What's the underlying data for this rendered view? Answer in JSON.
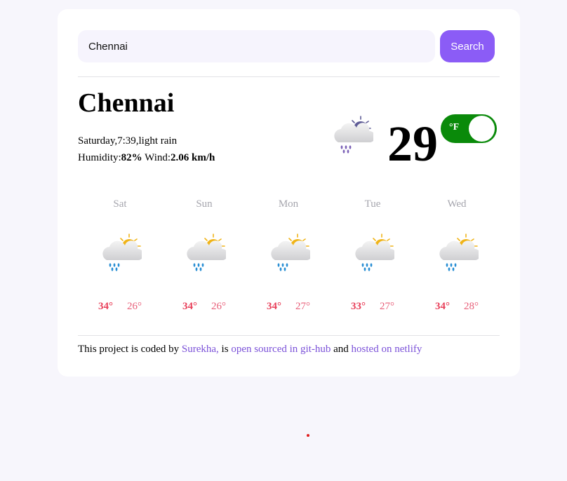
{
  "search": {
    "value": "Chennai",
    "button_label": "Search"
  },
  "current": {
    "city": "Chennai",
    "day_time_desc": "Saturday,7:39,light rain",
    "humidity_label": "Humidity:",
    "humidity_value": "82%",
    "wind_label": " Wind:",
    "wind_value": "2.06 km/h",
    "temperature": "29",
    "unit_toggle": "°F",
    "icon": "night-cloud-rain-icon"
  },
  "forecast": [
    {
      "day": "Sat",
      "high": "34°",
      "low": "26°",
      "icon": "sun-cloud-rain-icon"
    },
    {
      "day": "Sun",
      "high": "34°",
      "low": "26°",
      "icon": "sun-cloud-rain-icon"
    },
    {
      "day": "Mon",
      "high": "34°",
      "low": "27°",
      "icon": "sun-cloud-rain-icon"
    },
    {
      "day": "Tue",
      "high": "33°",
      "low": "27°",
      "icon": "sun-cloud-rain-icon"
    },
    {
      "day": "Wed",
      "high": "34°",
      "low": "28°",
      "icon": "sun-cloud-rain-icon"
    }
  ],
  "footer": {
    "text_1": "This project is coded by ",
    "author_link": "Surekha,",
    "text_2": " is ",
    "repo_link": "open sourced in git-hub",
    "text_3": " and ",
    "host_link": "hosted on netlify"
  },
  "colors": {
    "accent": "#8b5cf6",
    "toggle": "#0a8a0a",
    "high_temp": "#e8405a",
    "low_temp": "#e8607a",
    "link": "#7a50d8"
  }
}
